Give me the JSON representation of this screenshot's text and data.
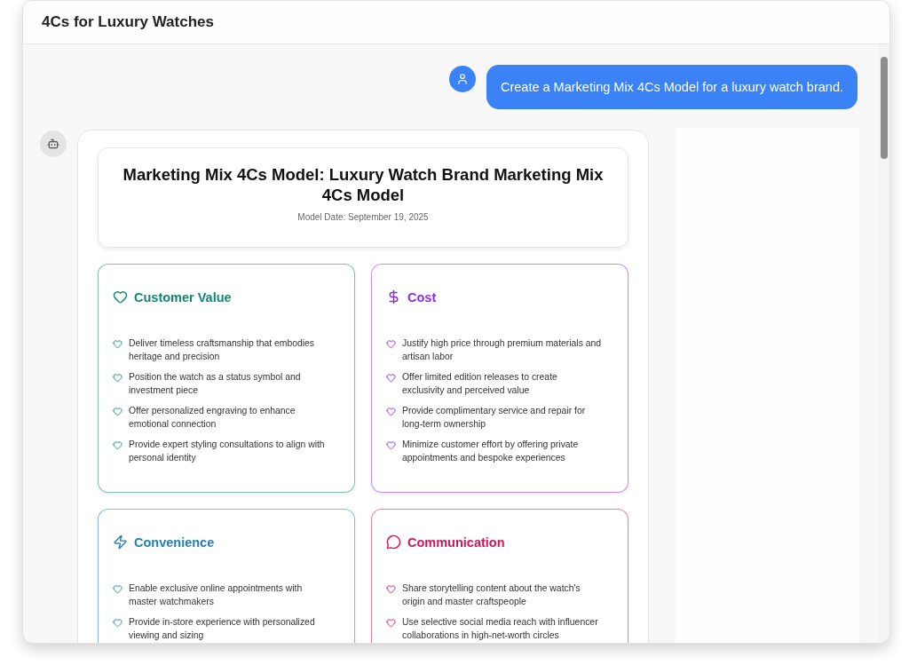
{
  "window": {
    "title": "4Cs for Luxury Watches"
  },
  "user_message": {
    "text": "Create a Marketing Mix 4Cs Model for a luxury watch brand."
  },
  "report": {
    "title": "Marketing Mix 4Cs Model: Luxury Watch Brand Marketing Mix 4Cs Model",
    "date": "Model Date: September 19, 2025",
    "cards": [
      {
        "kind": "value",
        "title": "Customer Value",
        "color": "#0f8a6e",
        "items": [
          "Deliver timeless craftsmanship that embodies heritage and precision",
          "Position the watch as a status symbol and investment piece",
          "Offer personalized engraving to enhance emotional connection",
          "Provide expert styling consultations to align with personal identity"
        ]
      },
      {
        "kind": "cost",
        "title": "Cost",
        "color": "#8b2be2",
        "items": [
          "Justify high price through premium materials and artisan labor",
          "Offer limited edition releases to create exclusivity and perceived value",
          "Provide complimentary service and repair for long-term ownership",
          "Minimize customer effort by offering private appointments and bespoke experiences"
        ]
      },
      {
        "kind": "convenience",
        "title": "Convenience",
        "color": "#1f7fb8",
        "items": [
          "Enable exclusive online appointments with master watchmakers",
          "Provide in-store experience with personalized viewing and sizing"
        ]
      },
      {
        "kind": "communication",
        "title": "Communication",
        "color": "#d4145a",
        "items": [
          "Share storytelling content about the watch's origin and master craftspeople",
          "Use selective social media reach with influencer collaborations in high-net-worth circles"
        ]
      }
    ]
  }
}
